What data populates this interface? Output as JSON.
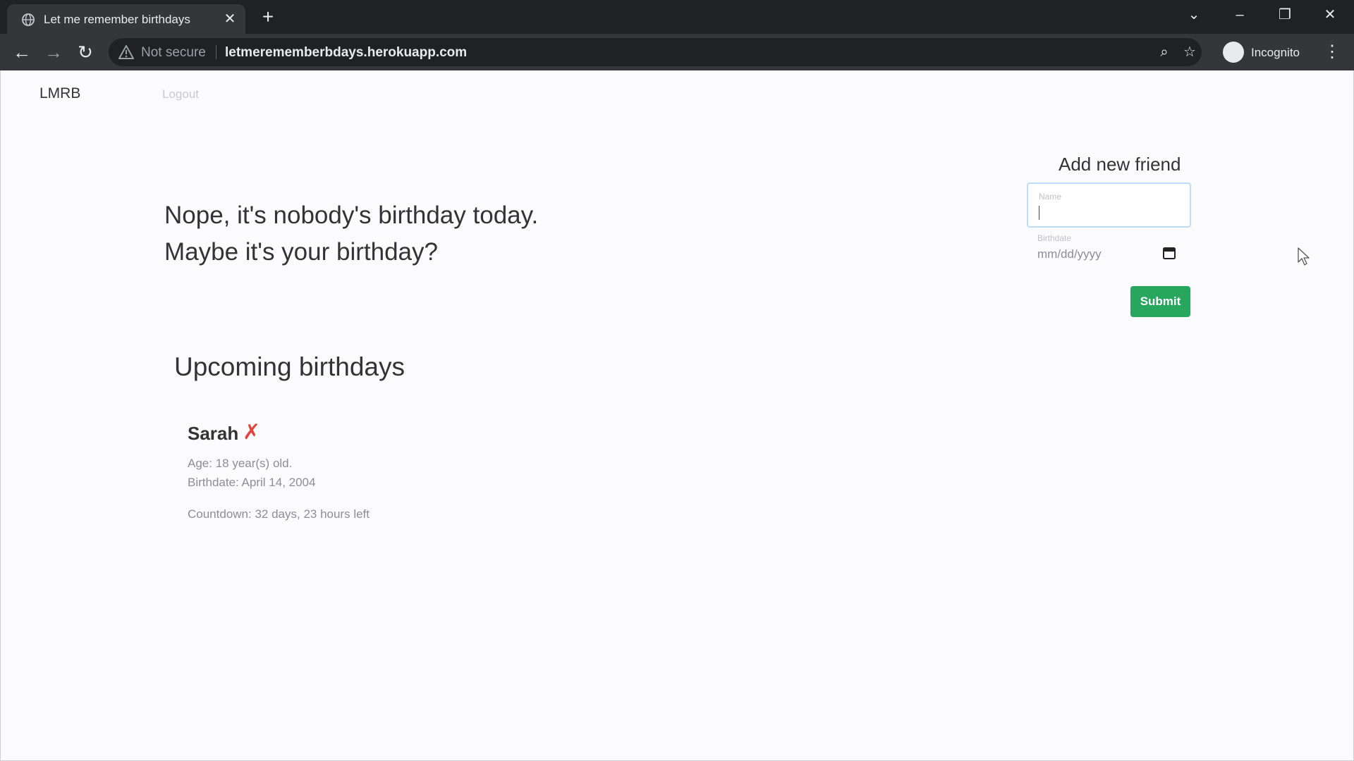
{
  "browser": {
    "tab_title": "Let me remember birthdays",
    "security_label": "Not secure",
    "url": "letmerememberbdays.herokuapp.com",
    "profile_label": "Incognito"
  },
  "site": {
    "brand": "LMRB",
    "logout": "Logout"
  },
  "hero": {
    "line1": "Nope, it's nobody's birthday today.",
    "line2": "Maybe it's your birthday?"
  },
  "upcoming": {
    "title": "Upcoming birthdays",
    "friends": [
      {
        "name": "Sarah",
        "delete_symbol": "✗",
        "age": "Age: 18 year(s) old.",
        "birthdate": "Birthdate: April 14, 2004",
        "countdown": "Countdown: 32 days, 23 hours left"
      }
    ]
  },
  "form": {
    "title": "Add new friend",
    "name_label": "Name",
    "birthdate_label": "Birthdate",
    "birthdate_placeholder": "mm/dd/yyyy",
    "submit_label": "Submit"
  },
  "colors": {
    "submit": "#28a65e",
    "delete": "#e0463d",
    "input_focus_border": "#bcdcf7"
  }
}
